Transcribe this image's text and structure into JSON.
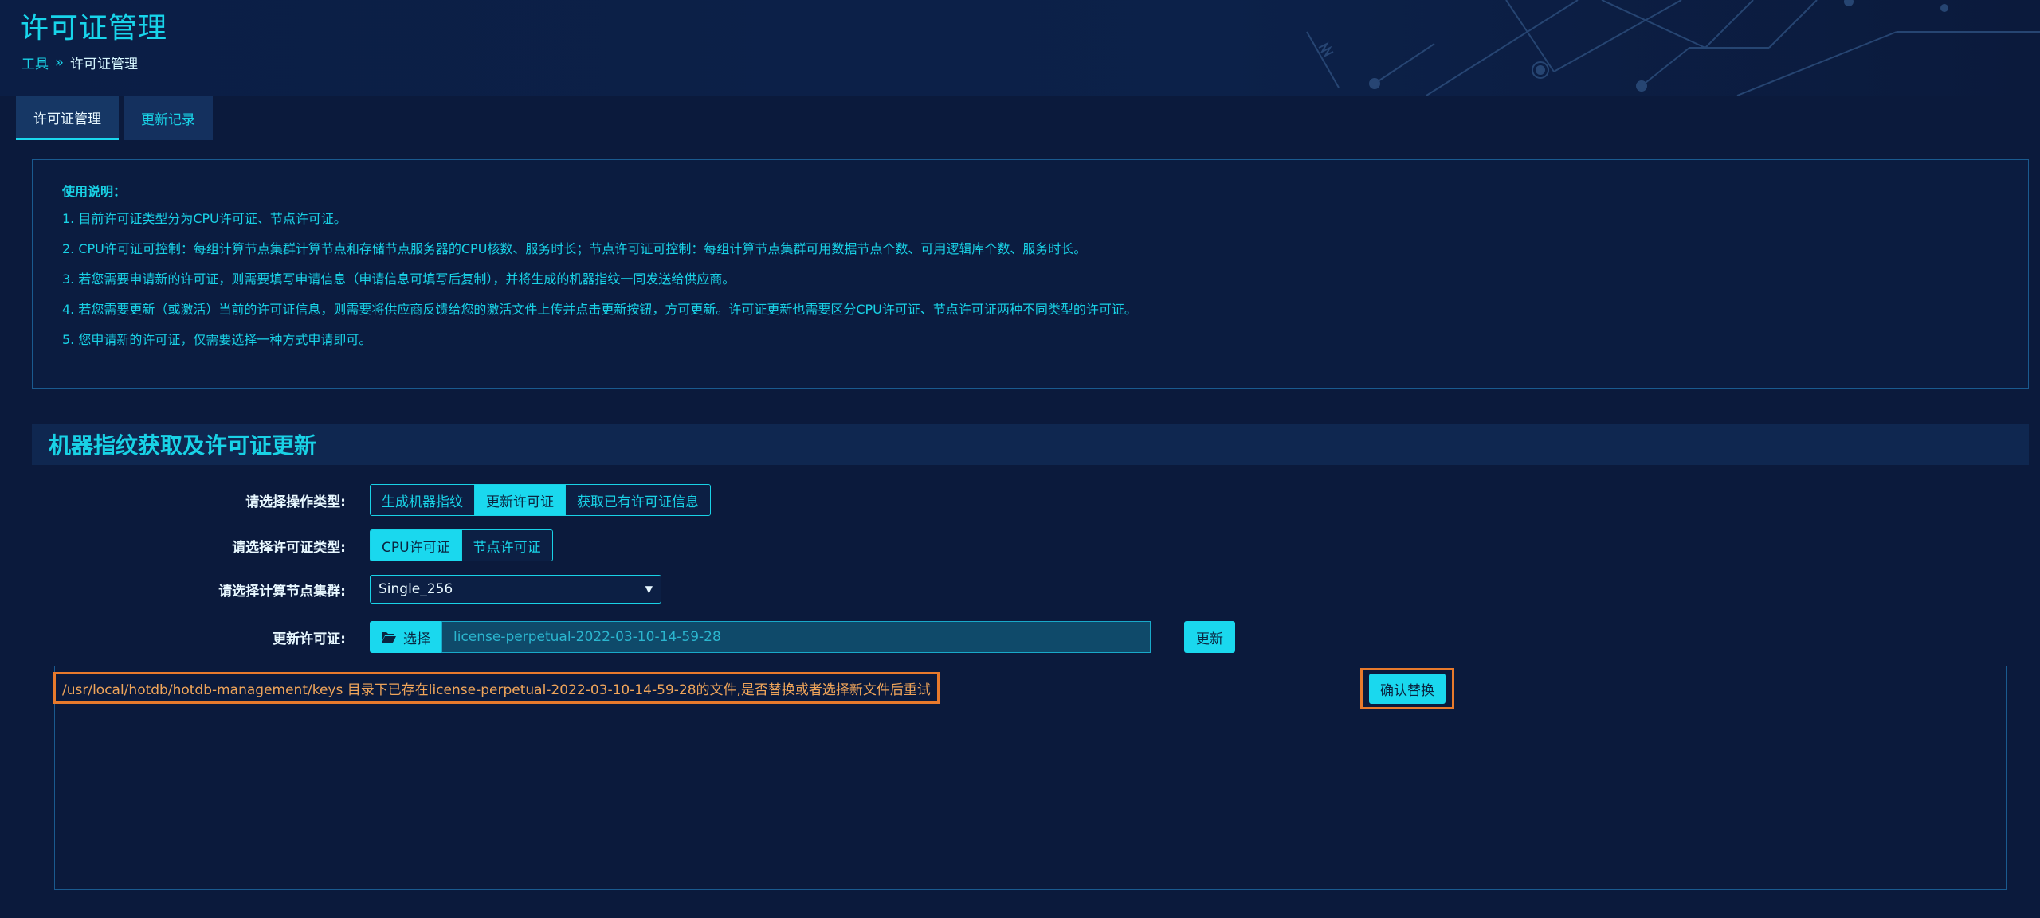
{
  "header": {
    "title": "许可证管理",
    "breadcrumb": {
      "parent": "工具",
      "separator": "»",
      "current": "许可证管理"
    }
  },
  "tabs": [
    {
      "label": "许可证管理",
      "active": true
    },
    {
      "label": "更新记录",
      "active": false
    }
  ],
  "instructions": {
    "title": "使用说明：",
    "lines": [
      "1. 目前许可证类型分为CPU许可证、节点许可证。",
      "2. CPU许可证可控制：每组计算节点集群计算节点和存储节点服务器的CPU核数、服务时长；节点许可证可控制：每组计算节点集群可用数据节点个数、可用逻辑库个数、服务时长。",
      "3. 若您需要申请新的许可证，则需要填写申请信息（申请信息可填写后复制），并将生成的机器指纹一同发送给供应商。",
      "4. 若您需要更新（或激活）当前的许可证信息，则需要将供应商反馈给您的激活文件上传并点击更新按钮，方可更新。许可证更新也需要区分CPU许可证、节点许可证两种不同类型的许可证。",
      "5. 您申请新的许可证，仅需要选择一种方式申请即可。"
    ]
  },
  "section": {
    "title": "机器指纹获取及许可证更新",
    "operation": {
      "label": "请选择操作类型:",
      "options": [
        "生成机器指纹",
        "更新许可证",
        "获取已有许可证信息"
      ],
      "selected": "更新许可证"
    },
    "license_type": {
      "label": "请选择许可证类型:",
      "options": [
        "CPU许可证",
        "节点许可证"
      ],
      "selected": "CPU许可证"
    },
    "cluster": {
      "label": "请选择计算节点集群:",
      "value": "Single_256"
    },
    "update_license": {
      "label": "更新许可证:",
      "choose_label": "选择",
      "file_name": "license-perpetual-2022-03-10-14-59-28",
      "update_label": "更新"
    },
    "result": {
      "message": "/usr/local/hotdb/hotdb-management/keys 目录下已存在license-perpetual-2022-03-10-14-59-28的文件,是否替换或者选择新文件后重试",
      "confirm_label": "确认替换"
    }
  },
  "colors": {
    "background": "#0b1a3c",
    "accent": "#1ad8ee",
    "highlight": "#e87a2c",
    "warning_text": "#f0a55a"
  }
}
